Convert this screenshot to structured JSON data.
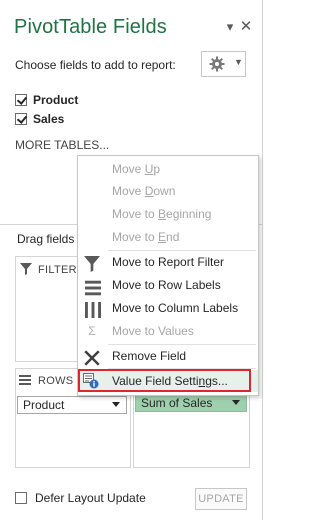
{
  "pane": {
    "title": "PivotTable Fields",
    "choose_label": "Choose fields to add to report:",
    "more_tables": "MORE TABLES...",
    "drag_label": "Drag fields",
    "fields": [
      {
        "label": "Product",
        "checked": true
      },
      {
        "label": "Sales",
        "checked": true
      }
    ],
    "areas": {
      "filters_label": "FILTERS",
      "rows_label": "ROWS",
      "rows_field": "Product",
      "values_field": "Sum of Sales"
    },
    "defer_label": "Defer Layout Update",
    "update_label": "UPDATE"
  },
  "context_menu": {
    "items": [
      {
        "label_pre": "Move ",
        "label_u": "U",
        "label_post": "p",
        "enabled": false,
        "icon": ""
      },
      {
        "label_pre": "Move ",
        "label_u": "D",
        "label_post": "own",
        "enabled": false,
        "icon": ""
      },
      {
        "label_pre": "Move to ",
        "label_u": "B",
        "label_post": "eginning",
        "enabled": false,
        "icon": ""
      },
      {
        "label_pre": "Move to ",
        "label_u": "E",
        "label_post": "nd",
        "enabled": false,
        "icon": ""
      },
      {
        "label_pre": "Move to Report Filter",
        "label_u": "",
        "label_post": "",
        "enabled": true,
        "icon": "filter-icon"
      },
      {
        "label_pre": "Move to Row Labels",
        "label_u": "",
        "label_post": "",
        "enabled": true,
        "icon": "rows-icon"
      },
      {
        "label_pre": "Move to Column Labels",
        "label_u": "",
        "label_post": "",
        "enabled": true,
        "icon": "columns-icon"
      },
      {
        "label_pre": "Move to Values",
        "label_u": "",
        "label_post": "",
        "enabled": false,
        "icon": "sigma-icon"
      },
      {
        "label_pre": "Remove Field",
        "label_u": "",
        "label_post": "",
        "enabled": true,
        "icon": "remove-x-icon"
      },
      {
        "label_pre": "Value Field Setti",
        "label_u": "n",
        "label_post": "gs...",
        "enabled": true,
        "icon": "field-settings-icon"
      }
    ]
  },
  "colors": {
    "title_green": "#217346",
    "values_chip": "#9fd0ae",
    "highlight_red": "#e0262d"
  }
}
